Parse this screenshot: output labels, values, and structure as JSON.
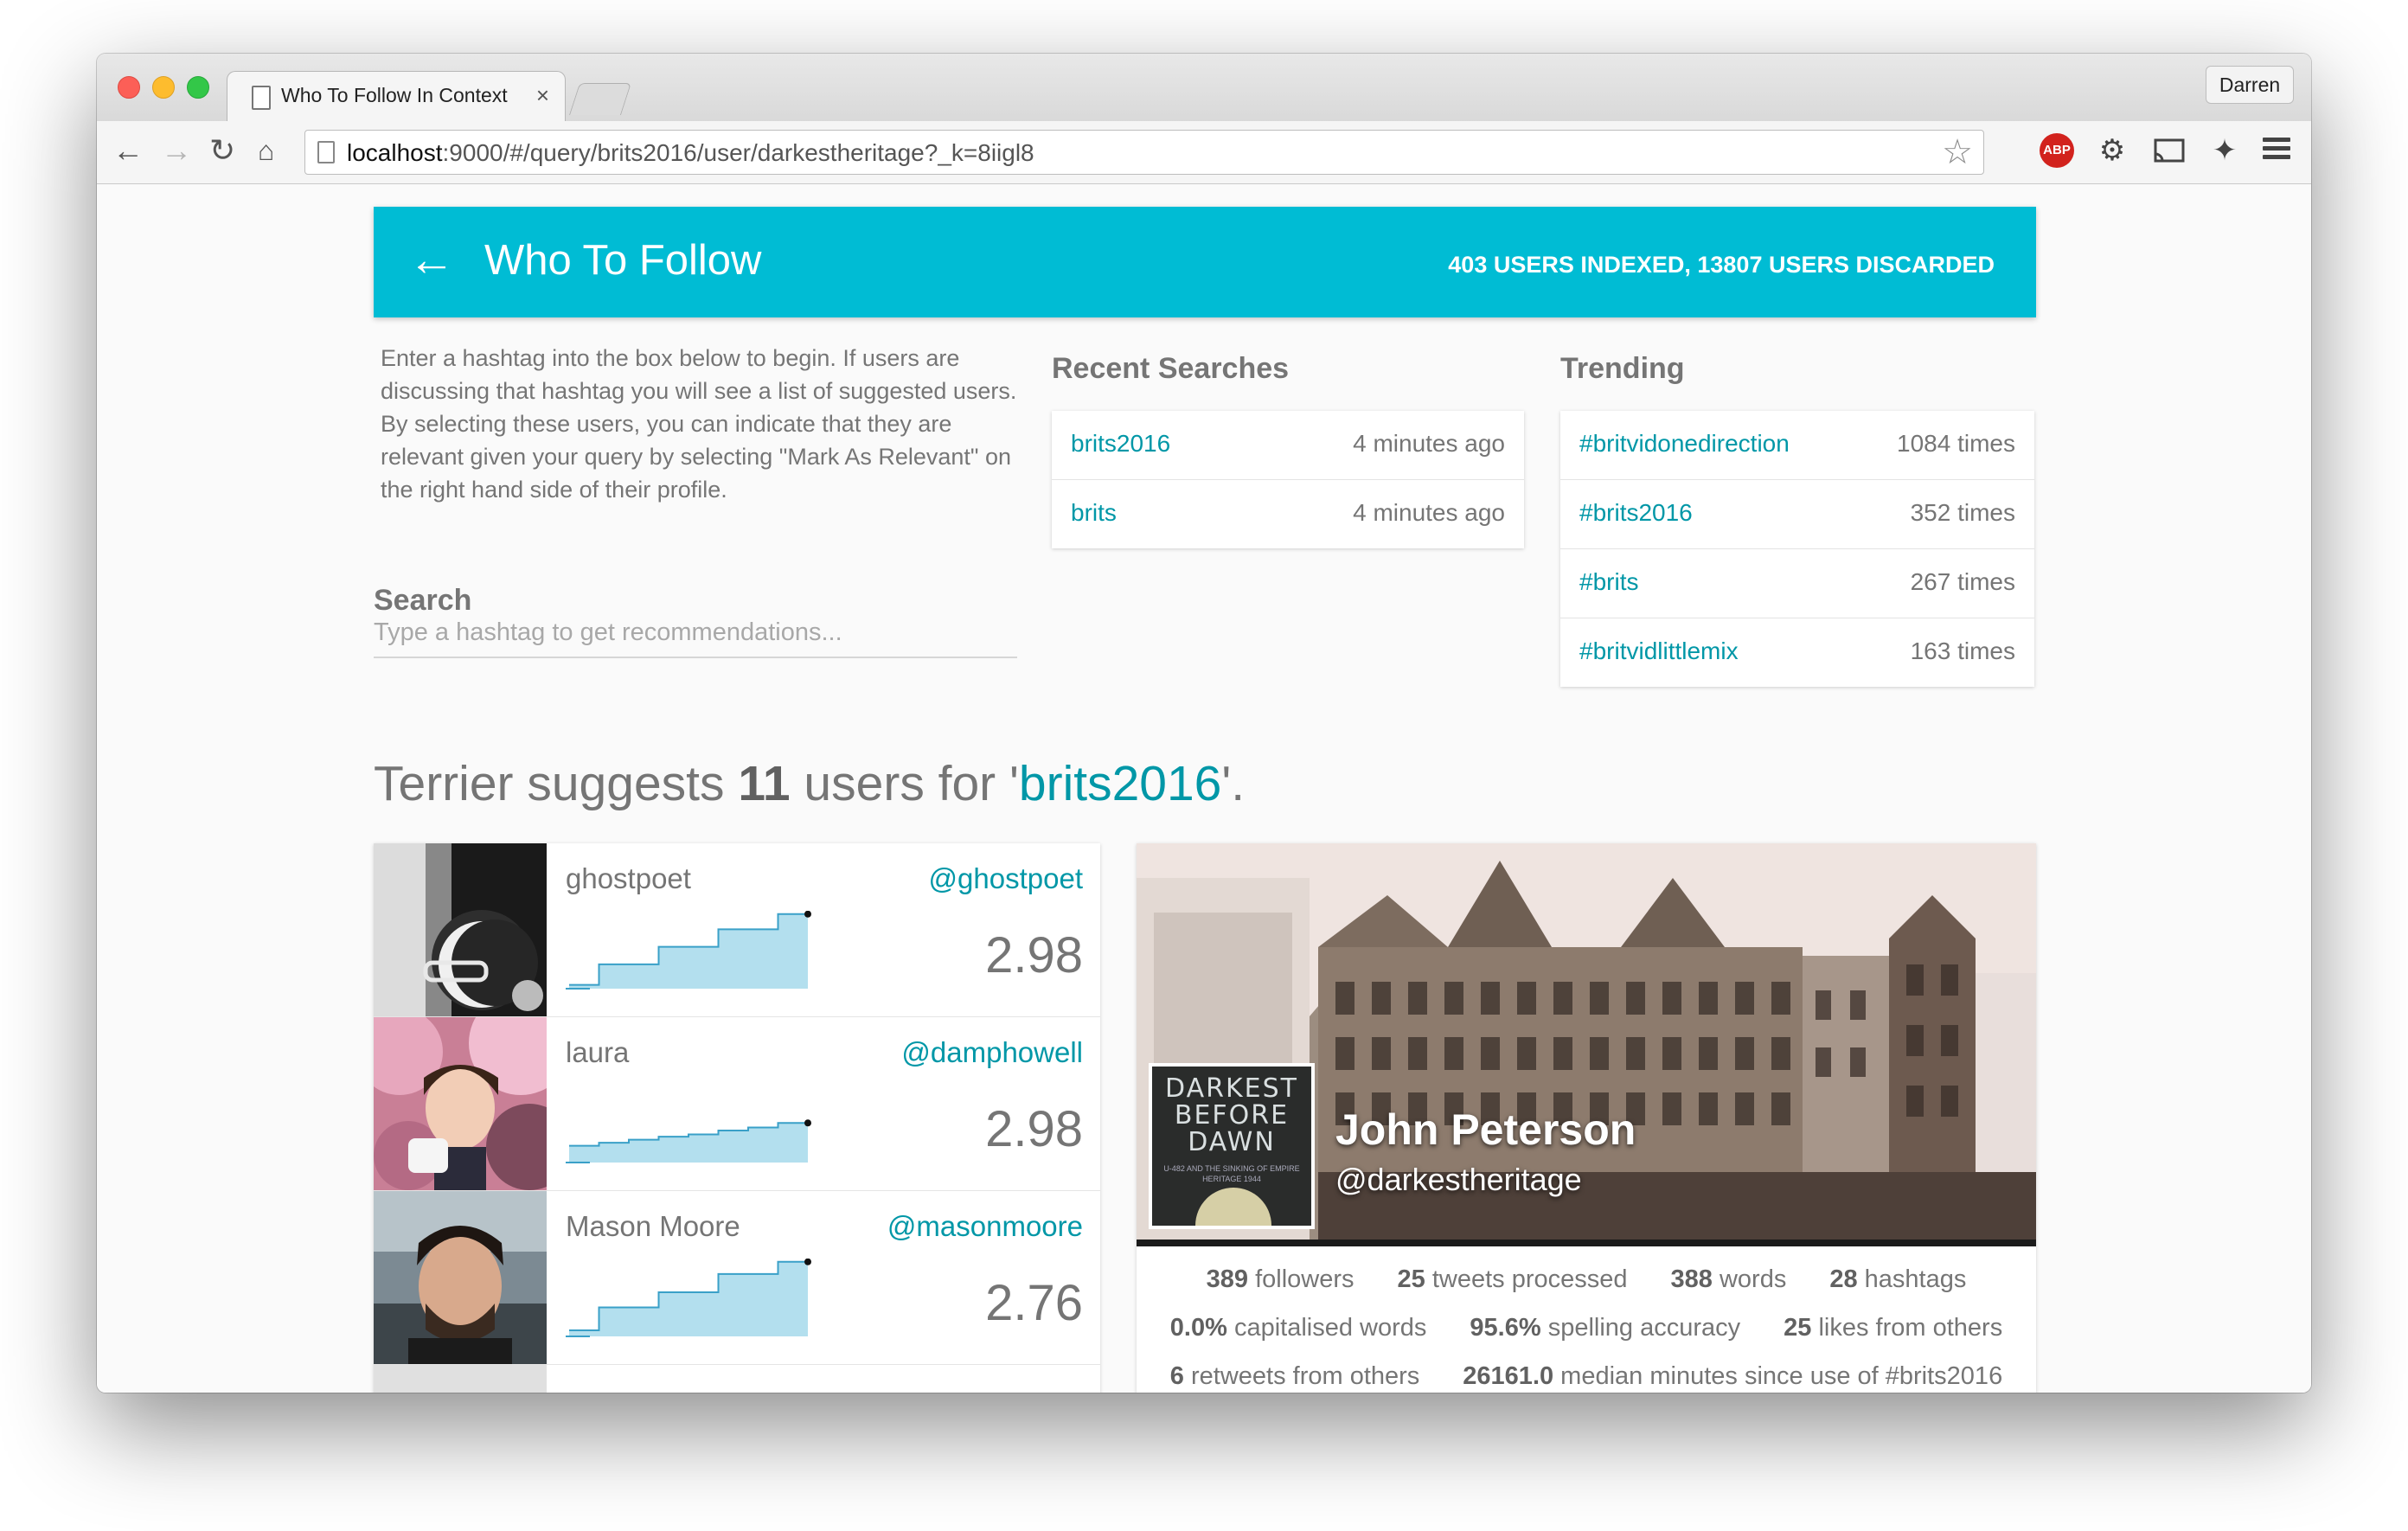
{
  "browser": {
    "tab_title": "Who To Follow In Context",
    "tab_close": "×",
    "profile": "Darren",
    "url_host": "localhost",
    "url_rest": ":9000/#/query/brits2016/user/darkestheritage?_k=8iigl8",
    "abp_label": "ABP",
    "icons": [
      "back-icon",
      "forward-icon",
      "reload-icon",
      "home-icon",
      "bookmark-star-icon",
      "adblock-icon",
      "extension-icon",
      "cast-icon",
      "extension2-icon",
      "menu-icon"
    ]
  },
  "appbar": {
    "back": "←",
    "title": "Who To Follow",
    "stats": "403 USERS INDEXED, 13807 USERS DISCARDED"
  },
  "intro": "Enter a hashtag into the box below to begin. If users are discussing that hashtag you will see a list of suggested users. By selecting these users, you can indicate that they are relevant given your query by selecting \"Mark As Relevant\" on the right hand side of their profile.",
  "recent": {
    "heading": "Recent Searches",
    "items": [
      {
        "query": "brits2016",
        "time": "4 minutes ago"
      },
      {
        "query": "brits",
        "time": "4 minutes ago"
      }
    ]
  },
  "trending": {
    "heading": "Trending",
    "items": [
      {
        "tag": "#britvidonedirection",
        "count": "1084 times"
      },
      {
        "tag": "#brits2016",
        "count": "352 times"
      },
      {
        "tag": "#brits",
        "count": "267 times"
      },
      {
        "tag": "#britvidlittlemix",
        "count": "163 times"
      }
    ]
  },
  "search": {
    "heading": "Search",
    "placeholder": "Type a hashtag to get recommendations..."
  },
  "suggest": {
    "pre": "Terrier suggests ",
    "count": "11",
    "mid": " users for '",
    "query": "brits2016",
    "post": "'."
  },
  "users": [
    {
      "name": "ghostpoet",
      "handle": "@ghostpoet",
      "score": "2.98",
      "trend": [
        0.05,
        0.32,
        0.32,
        0.55,
        0.55,
        0.78,
        0.78,
        0.98
      ]
    },
    {
      "name": "laura",
      "handle": "@damphowell",
      "score": "2.98",
      "trend": [
        0.22,
        0.26,
        0.3,
        0.34,
        0.37,
        0.42,
        0.46,
        0.52
      ]
    },
    {
      "name": "Mason Moore",
      "handle": "@masonmoore",
      "score": "2.76",
      "trend": [
        0.08,
        0.38,
        0.38,
        0.58,
        0.58,
        0.82,
        0.82,
        0.98
      ]
    },
    {
      "name": "",
      "handle": "",
      "score": "",
      "trend": []
    }
  ],
  "profile": {
    "name": "John Peterson",
    "handle": "@darkestheritage",
    "book_title": "DARKEST BEFORE DAWN",
    "book_sub": "U-482 AND THE SINKING OF EMPIRE HERITAGE 1944",
    "stats_row1": [
      {
        "v": "389",
        "l": " followers"
      },
      {
        "v": "25",
        "l": " tweets processed"
      },
      {
        "v": "388",
        "l": " words"
      },
      {
        "v": "28",
        "l": " hashtags"
      }
    ],
    "stats_row2": [
      {
        "v": "0.0%",
        "l": " capitalised words"
      },
      {
        "v": "95.6%",
        "l": " spelling accuracy"
      },
      {
        "v": "25",
        "l": " likes from others"
      }
    ],
    "stats_row3": [
      {
        "v": "6",
        "l": " retweets from others"
      },
      {
        "v": "26161.0",
        "l": " median minutes since use of #brits2016"
      }
    ]
  },
  "colors": {
    "accent": "#00bcd4",
    "link": "#0097a7",
    "muted": "#757575"
  }
}
